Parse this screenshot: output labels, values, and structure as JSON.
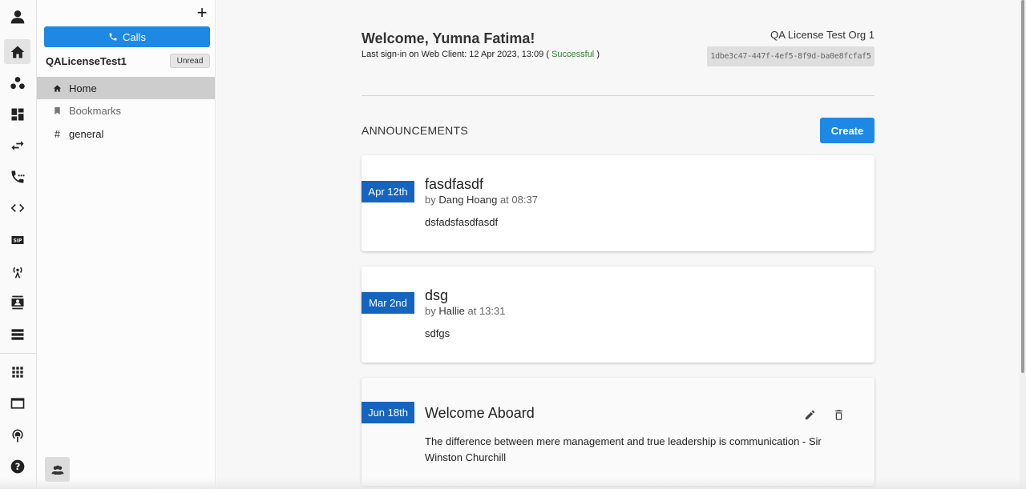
{
  "rail": {
    "items": [
      {
        "name": "profile-icon"
      },
      {
        "name": "home-icon",
        "active": true
      },
      {
        "name": "groups-icon"
      },
      {
        "name": "dashboard-icon"
      },
      {
        "name": "transfer-icon"
      },
      {
        "name": "dialpad-icon"
      },
      {
        "name": "code-icon"
      },
      {
        "name": "sip-icon"
      },
      {
        "name": "antenna-icon"
      },
      {
        "name": "contacts-icon"
      },
      {
        "name": "list-icon"
      },
      {
        "name": "apps-grid-icon"
      },
      {
        "name": "window-icon"
      },
      {
        "name": "podcast-icon"
      },
      {
        "name": "help-icon"
      }
    ]
  },
  "panel": {
    "plus": "+",
    "calls_label": "Calls",
    "org_name": "QALicenseTest1",
    "unread_label": "Unread",
    "nav": [
      {
        "label": "Home",
        "icon": "home-icon",
        "active": true
      },
      {
        "label": "Bookmarks",
        "icon": "bookmark-icon"
      },
      {
        "label": "general",
        "icon": "hash-icon"
      }
    ],
    "hash_symbol": "#"
  },
  "header": {
    "welcome": "Welcome, Yumna Fatima!",
    "last_signin_prefix": "Last sign-in on Web Client: 12 Apr 2023, 13:09 ( ",
    "last_signin_status": "Successful",
    "last_signin_suffix": " )",
    "org_title": "QA License Test Org 1",
    "org_id": "1dbe3c47-447f-4ef5-8f9d-ba0e8fcfaf5"
  },
  "announcements": {
    "title": "ANNOUNCEMENTS",
    "create_label": "Create",
    "by_prefix": "by ",
    "at_prefix": " at ",
    "items": [
      {
        "date": "Apr 12th",
        "title": "fasdfasdf",
        "author": "Dang Hoang",
        "time": "08:37",
        "body": "dsfadsfasdfasdf"
      },
      {
        "date": "Mar 2nd",
        "title": "dsg",
        "author": "Hallie",
        "time": "13:31",
        "body": "sdfgs"
      },
      {
        "date": "Jun 18th",
        "title": "Welcome Aboard",
        "body": "The difference between mere management and true leadership is communication - Sir Winston Churchill"
      }
    ]
  }
}
